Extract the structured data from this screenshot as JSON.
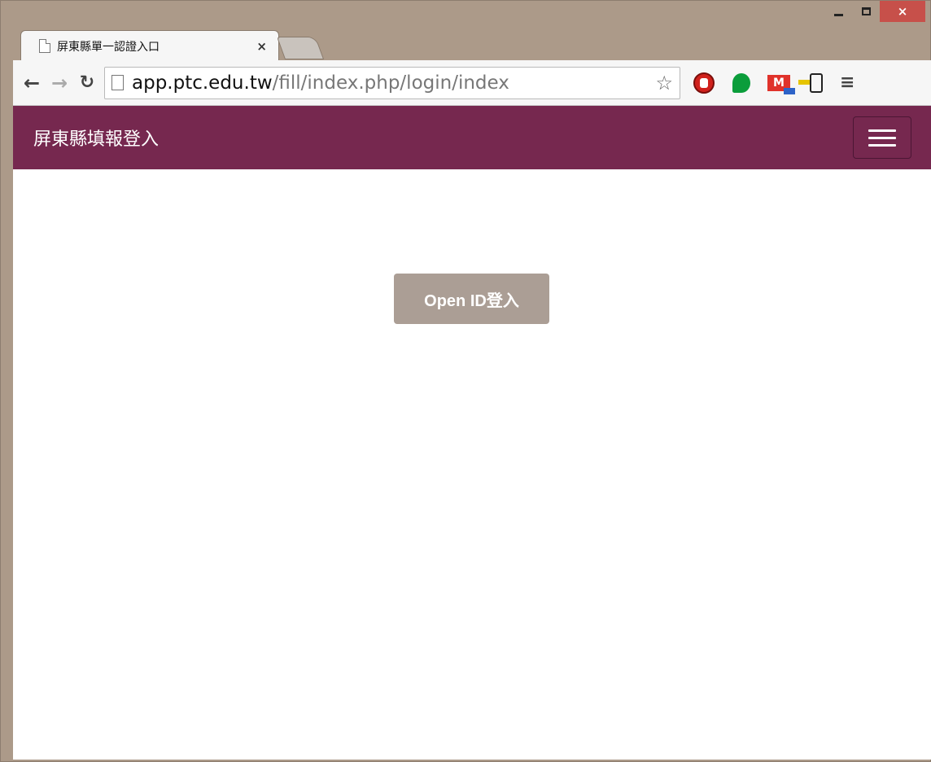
{
  "browser": {
    "tab_title": "屏東縣單一認證入口",
    "tab_close": "×",
    "url_host": "app.ptc.edu.tw",
    "url_path": "/fill/index.php/login/index",
    "window_close": "×"
  },
  "navbar": {
    "brand": "屏東縣填報登入"
  },
  "main": {
    "login_button": "Open ID登入"
  },
  "colors": {
    "navbar_bg": "#76284f",
    "button_bg": "#ab9e95",
    "frame": "#ac9a89"
  }
}
